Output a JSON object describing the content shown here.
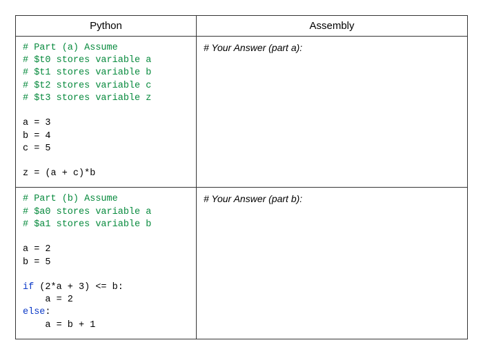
{
  "headers": {
    "python": "Python",
    "assembly": "Assembly"
  },
  "part_a": {
    "answer_label": "# Your Answer (part a):",
    "comments": {
      "c1": "# Part (a) Assume",
      "c2": "# $t0 stores variable a",
      "c3": "# $t1 stores variable b",
      "c4": "# $t2 stores variable c",
      "c5": "# $t3 stores variable z"
    },
    "code": {
      "l1": "a = 3",
      "l2": "b = 4",
      "l3": "c = 5",
      "l4": "z = (a + c)*b"
    }
  },
  "part_b": {
    "answer_label": "# Your Answer (part b):",
    "comments": {
      "c1": "# Part (b) Assume",
      "c2": "# $a0 stores variable a",
      "c3": "# $a1 stores variable b"
    },
    "code": {
      "l1": "a = 2",
      "l2": "b = 5",
      "l3_if": "if",
      "l3_cond": " (2*a + 3) <= b:",
      "l4": "    a = 2",
      "l5_else": "else",
      "l5_colon": ":",
      "l6": "    a = b + 1"
    }
  }
}
